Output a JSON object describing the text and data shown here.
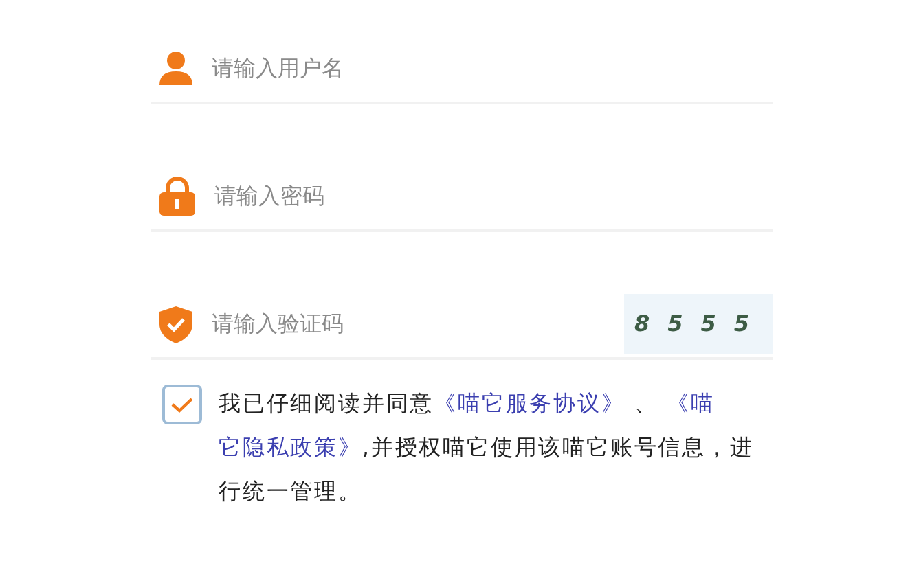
{
  "fields": [
    {
      "kind": "user",
      "placeholder": "请输入用户名"
    },
    {
      "kind": "lock",
      "placeholder": "请输入密码"
    },
    {
      "kind": "shield",
      "placeholder": "请输入验证码",
      "captcha": "8555"
    }
  ],
  "agreement": {
    "checked": true,
    "segments": [
      {
        "kind": "text",
        "text": "我已仔细阅读并同意"
      },
      {
        "kind": "link",
        "text": "《喵它服务协议》"
      },
      {
        "kind": "text",
        "text": " 、 "
      },
      {
        "kind": "link",
        "text": "《喵"
      },
      {
        "kind": "link",
        "text": "它隐私政策》"
      },
      {
        "kind": "text",
        "text": ",并授权喵它使用该喵它账号信息，进行统一管理。"
      }
    ]
  }
}
